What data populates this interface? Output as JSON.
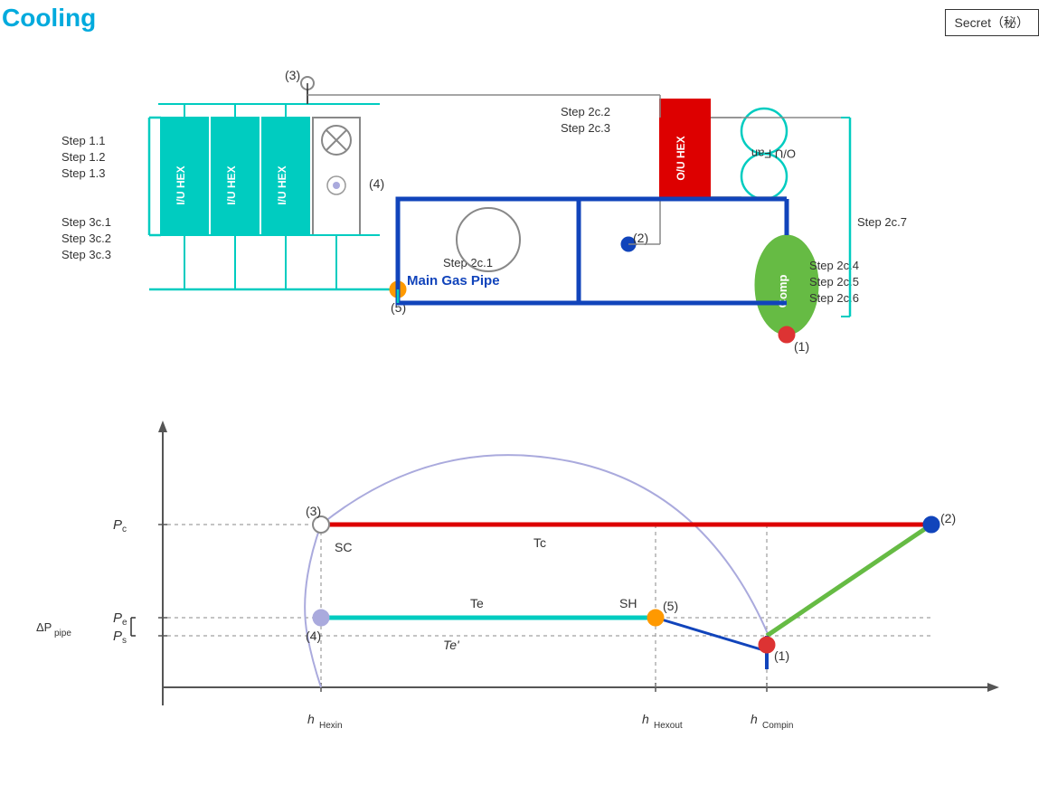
{
  "title": "Cooling",
  "secret_badge": "Secret（秘）",
  "step_labels": {
    "step1_1": "Step 1.1",
    "step1_2": "Step 1.2",
    "step1_3": "Step 1.3",
    "step3c1": "Step 3c.1",
    "step3c2": "Step 3c.2",
    "step3c3": "Step 3c.3",
    "step2c1": "Step 2c.1",
    "step2c2": "Step 2c.2",
    "step2c3": "Step 2c.3",
    "step2c4": "Step 2c.4",
    "step2c5": "Step 2c.5",
    "step2c6": "Step 2c.6",
    "step2c7": "Step 2c.7"
  },
  "labels": {
    "main_gas_pipe": "Main Gas Pipe",
    "iu_hex": "I/U HEX",
    "ou_hex": "O/U HEX",
    "ou_fan": "O/U Fan",
    "comp": "Comp",
    "sc": "SC",
    "tc": "Tc",
    "te": "Te",
    "te_prime": "Te'",
    "sh": "SH",
    "pc": "Pc",
    "pe": "Pe",
    "ps": "Ps",
    "delta_p": "ΔPpipe",
    "h_hexin": "hHexin",
    "h_hexout": "hHexout",
    "h_compin": "hCompin",
    "point1": "(1)",
    "point2": "(2)",
    "point3": "(3)",
    "point4": "(4)",
    "point5": "(5)"
  },
  "colors": {
    "title": "#00AADD",
    "teal": "#00CCC0",
    "red": "#DD0000",
    "blue_dark": "#1144AA",
    "green": "#66BB44",
    "orange": "#FF9900",
    "gray": "#888888",
    "purple_light": "#AAAADD"
  }
}
